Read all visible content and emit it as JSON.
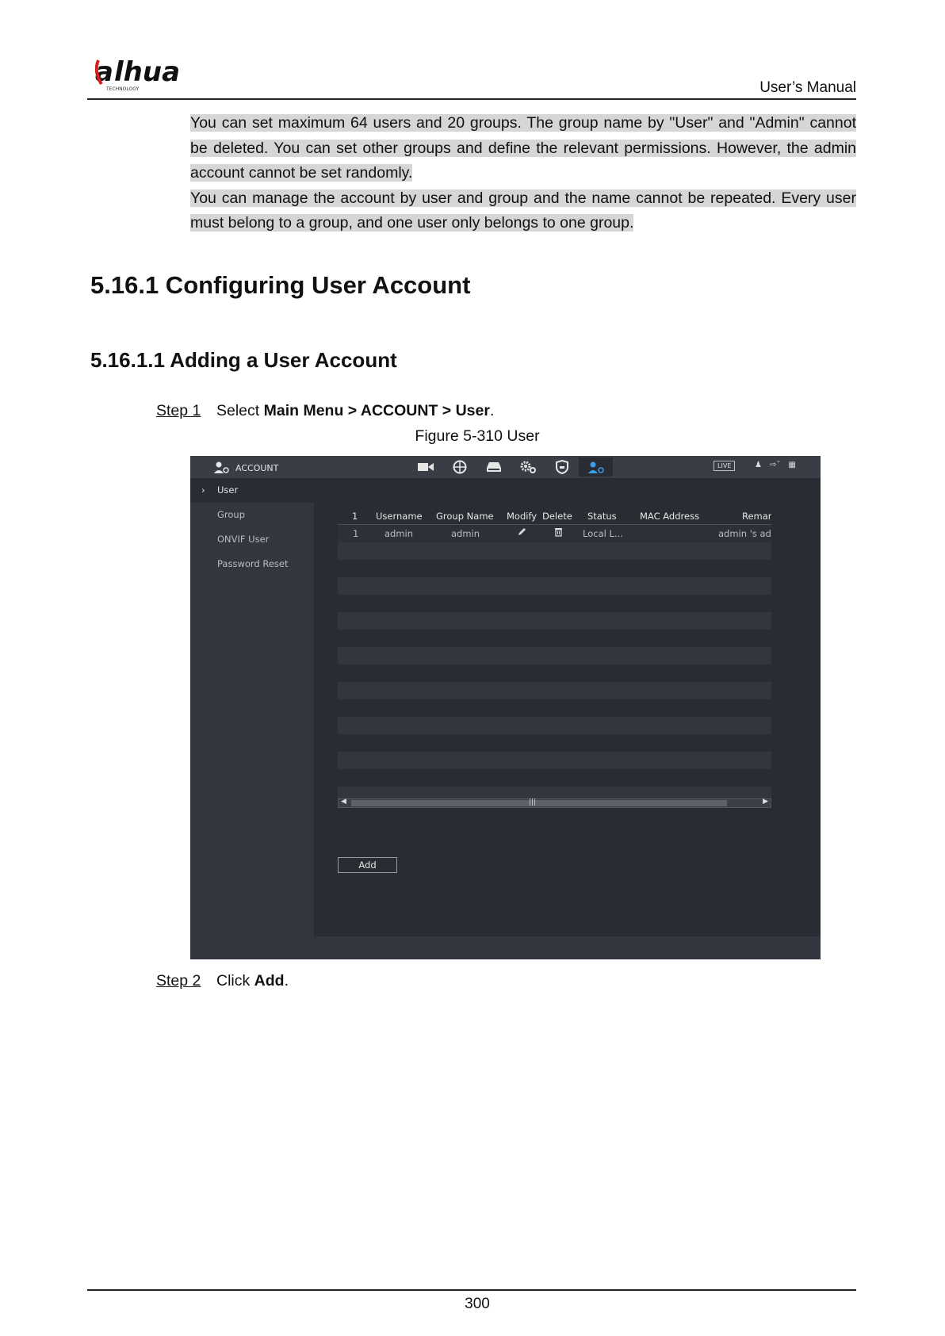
{
  "header": {
    "logo_text": "alhua",
    "logo_sub": "TECHNOLOGY",
    "manual_title": "User’s Manual"
  },
  "notes": [
    "You can set maximum 64 users and 20 groups. The group name by \"User\" and \"Admin\" cannot be deleted. You can set other groups and define the relevant permissions. However, the admin account cannot be set randomly.",
    "You can manage the account by user and group and the name cannot be repeated. Every user must belong to a group, and one user only belongs to one group."
  ],
  "section_title": "5.16.1 Configuring User Account",
  "subsection_title": "5.16.1.1 Adding a User Account",
  "step1": {
    "label": "Step 1",
    "text_pre": "Select ",
    "bold": "Main Menu > ACCOUNT > User",
    "text_post": "."
  },
  "figure_caption": "Figure 5-310 User",
  "screen": {
    "title": "ACCOUNT",
    "live": "LIVE",
    "nav_icons": [
      "camera-icon",
      "network-icon",
      "storage-icon",
      "system-gear-icon",
      "security-shield-icon",
      "account-icon"
    ],
    "sidebar": [
      "User",
      "Group",
      "ONVIF User",
      "Password Reset"
    ],
    "table": {
      "headers": [
        "1",
        "Username",
        "Group Name",
        "Modify",
        "Delete",
        "Status",
        "MAC Address",
        "Remar"
      ],
      "rows": [
        [
          "1",
          "admin",
          "admin",
          "",
          "",
          "Local L...",
          "",
          "admin 's ad"
        ]
      ]
    },
    "add_label": "Add"
  },
  "step2": {
    "label": "Step 2",
    "text_pre": "Click ",
    "bold": "Add",
    "text_post": "."
  },
  "page_number": "300"
}
